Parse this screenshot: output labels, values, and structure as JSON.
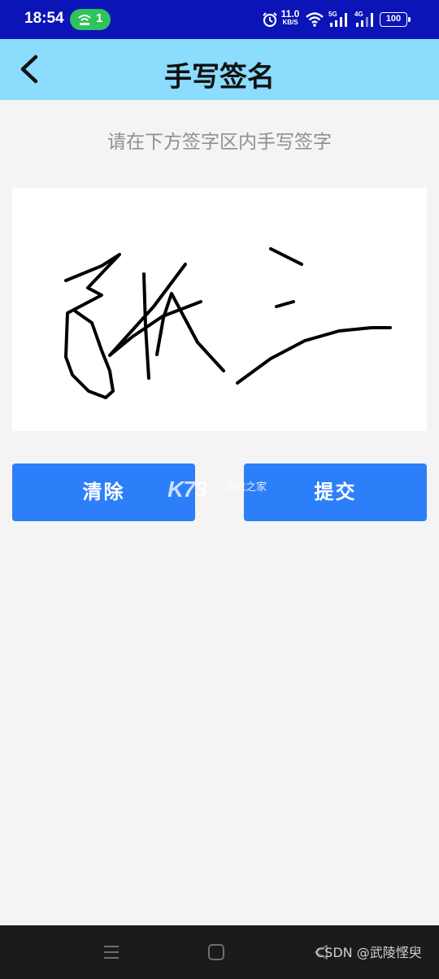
{
  "status_bar": {
    "time": "18:54",
    "hotspot_count": "1",
    "net_speed_value": "11.0",
    "net_speed_unit": "KB/S",
    "sim1_label": "5G",
    "sim2_label": "4G",
    "battery": "100",
    "icons": [
      "alarm-icon",
      "wifi-icon",
      "signal-5g-icon",
      "signal-4g-icon",
      "battery-icon"
    ]
  },
  "header": {
    "back_icon": "chevron-left-icon",
    "title": "手写签名"
  },
  "hint": "请在下方签字区内手写签字",
  "signature": {
    "stroke_color": "#000000"
  },
  "buttons": {
    "clear_label": "清除",
    "submit_label": "提交"
  },
  "watermark": {
    "logo": "K73",
    "text": "游戏之家"
  },
  "nav_bar": {
    "icons": [
      "menu-icon",
      "home-icon",
      "back-triangle-icon"
    ],
    "credit": "CSDN @武陵悭臾"
  },
  "colors": {
    "status_bar": "#0b14b6",
    "header": "#8bdcfd",
    "button": "#2d7ff9",
    "background": "#f4f4f5",
    "nav_bar": "#1b1b1b"
  }
}
